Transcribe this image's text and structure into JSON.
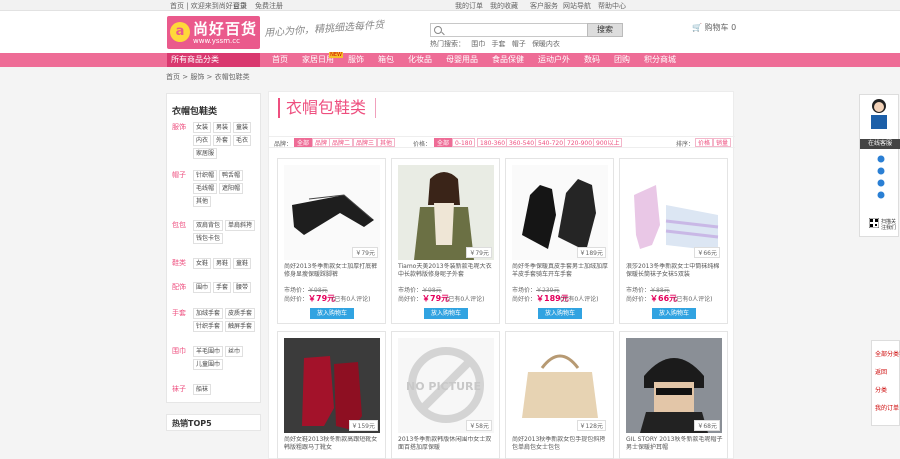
{
  "topbar": {
    "left": "首页 | 欢迎来到尚好百货",
    "login": "登录",
    "register": "免费注册",
    "links": [
      "我的订单",
      "我的收藏",
      "客户服务",
      "网站导航",
      "帮助中心"
    ]
  },
  "logo": {
    "icon": "a",
    "name": "尚好百货",
    "url": "www.yssm.cc",
    "slogan": "用心为你，精挑细选每件货"
  },
  "search": {
    "placeholder": "",
    "button": "搜索",
    "hot_label": "热门搜索：",
    "hot": [
      "围巾",
      "手套",
      "帽子",
      "保暖内衣"
    ]
  },
  "cart": {
    "label": "购物车",
    "count": "0"
  },
  "nav": {
    "category_label": "所有商品分类",
    "items": [
      {
        "label": "首页"
      },
      {
        "label": "家居日用",
        "new": "NEW"
      },
      {
        "label": "服饰"
      },
      {
        "label": "箱包"
      },
      {
        "label": "化妆品"
      },
      {
        "label": "母婴用品"
      },
      {
        "label": "食品保健"
      },
      {
        "label": "运动户外"
      },
      {
        "label": "数码"
      },
      {
        "label": "团购"
      },
      {
        "label": "积分商城"
      }
    ]
  },
  "breadcrumb": "首页 > 服饰 > 衣帽包鞋类",
  "category_title": "衣帽包鞋类",
  "sidebar": {
    "title": "衣帽包鞋类",
    "groups": [
      {
        "name": "服饰",
        "links": [
          "女装",
          "男装",
          "童装",
          "内衣",
          "外套",
          "毛衣",
          "家居服"
        ]
      },
      {
        "name": "帽子",
        "links": [
          "针织帽",
          "鸭舌帽",
          "毛线帽",
          "遮阳帽",
          "其他"
        ]
      },
      {
        "name": "包包",
        "links": [
          "双肩背包",
          "单肩斜挎",
          "钱包卡包"
        ]
      },
      {
        "name": "鞋类",
        "links": [
          "女鞋",
          "男鞋",
          "童鞋"
        ]
      },
      {
        "name": "配饰",
        "links": [
          "围巾",
          "手套",
          "腰带"
        ]
      },
      {
        "name": "手套",
        "links": [
          "加绒手套",
          "皮质手套",
          "针织手套",
          "触屏手套"
        ]
      },
      {
        "name": "围巾",
        "links": [
          "羊毛围巾",
          "丝巾",
          "儿童围巾"
        ]
      },
      {
        "name": "袜子",
        "links": [
          "船袜"
        ]
      }
    ],
    "tops_label": "热销TOP5"
  },
  "filter": {
    "brand_label": "品牌：",
    "brands": [
      "全部",
      "品牌",
      "品牌二",
      "品牌三",
      "其他"
    ],
    "price_label": "价格：",
    "prices": [
      "全部",
      "0-180",
      "180-360",
      "360-540",
      "540-720",
      "720-900",
      "900以上"
    ],
    "sort_label": "排序：",
    "sorts": [
      "价格",
      "销量"
    ]
  },
  "products": [
    {
      "title": "尚好2013冬季新款女士加厚打底裤修身显瘦保暖踩脚裤",
      "badge": "￥79元",
      "orig": "￥98元",
      "price": "￥79元",
      "sold": "(已有0人评论)",
      "buy": "放入购物车",
      "img": "tights"
    },
    {
      "title": "Tiamo天美2013冬装新款毛呢大衣中长款韩版修身呢子外套",
      "badge": "￥79元",
      "orig": "￥98元",
      "price": "￥79元",
      "sold": "(已有0人评论)",
      "buy": "放入购物车",
      "img": "coat"
    },
    {
      "title": "尚好冬季保暖真皮手套男士加绒加厚羊皮手套骑车开车手套",
      "badge": "￥189元",
      "orig": "￥239元",
      "price": "￥189元",
      "sold": "(已有0人评论)",
      "buy": "放入购物车",
      "img": "gloves"
    },
    {
      "title": "浪莎2013冬季新款女士中筒袜纯棉保暖长筒袜子女袜5双装",
      "badge": "￥66元",
      "orig": "￥88元",
      "price": "￥66元",
      "sold": "(已有0人评论)",
      "buy": "放入购物车",
      "img": "socks"
    },
    {
      "title": "尚好女鞋2013秋冬新款高跟短靴女韩版粗跟马丁靴女",
      "badge": "￥159元",
      "orig": "",
      "price": "",
      "sold": "",
      "buy": "",
      "img": "boots"
    },
    {
      "title": "2013冬季新款韩版休闲围巾女士双面百搭加厚保暖",
      "badge": "￥58元",
      "orig": "",
      "price": "",
      "sold": "",
      "buy": "",
      "img": "none"
    },
    {
      "title": "尚好2013秋季新款女包手提包斜挎包单肩包女士包包",
      "badge": "￥128元",
      "orig": "",
      "price": "",
      "sold": "",
      "buy": "",
      "img": "bag"
    },
    {
      "title": "GIL STORY 2013秋冬新款毛呢帽子男士保暖护耳帽",
      "badge": "￥68元",
      "orig": "",
      "price": "",
      "sold": "",
      "buy": "",
      "img": "hat"
    }
  ],
  "product_labels": {
    "orig_label": "市场价：",
    "price_label": "尚好价："
  },
  "no_picture": "NO PICTURE",
  "service": {
    "title": "在线客服",
    "qr_text": "扫描关注我们"
  },
  "right_tab": {
    "items": [
      "全部分类导航",
      "返回",
      "分类",
      "我的订单"
    ]
  },
  "colors": {
    "brand": "#ee6c96",
    "accent": "#e4005b",
    "button": "#31a3e1"
  }
}
